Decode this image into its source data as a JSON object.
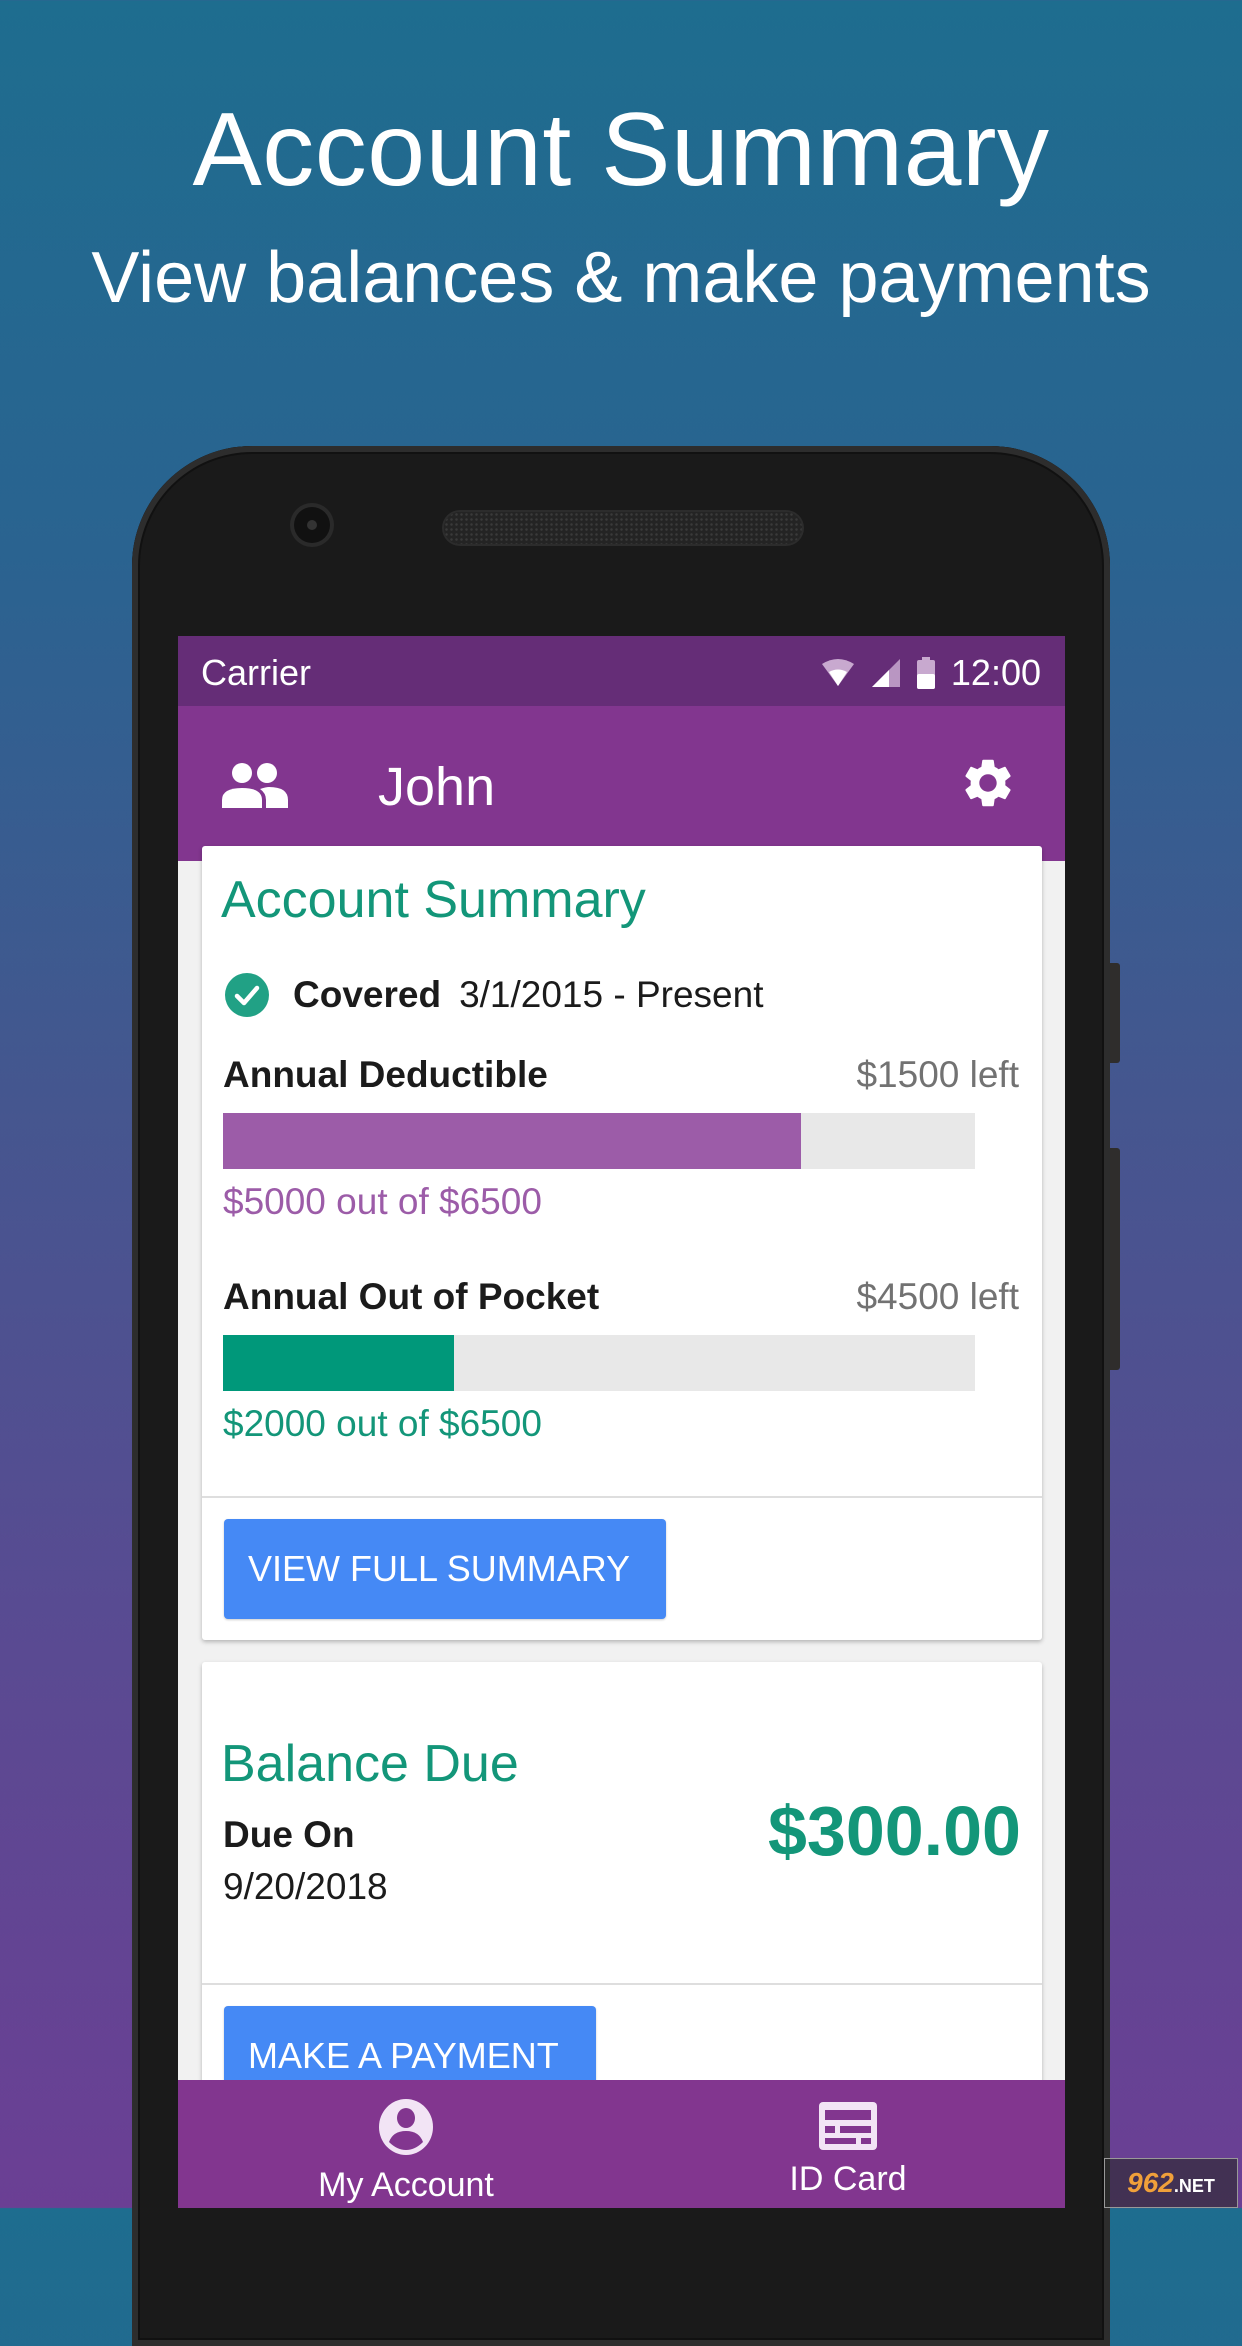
{
  "promo": {
    "title": "Account Summary",
    "subtitle": "View balances & make payments"
  },
  "status_bar": {
    "carrier": "Carrier",
    "time": "12:00",
    "icons": [
      "wifi-icon",
      "cell-signal-icon",
      "battery-icon"
    ]
  },
  "app_bar": {
    "title": "John",
    "left_icon": "people-icon",
    "right_icon": "gear-icon"
  },
  "account_summary": {
    "title": "Account Summary",
    "coverage": {
      "status": "Covered",
      "period": "3/1/2015 - Present",
      "icon": "check-circle-icon"
    },
    "meters": [
      {
        "label": "Annual Deductible",
        "remaining": "$1500 left",
        "caption": "$5000 out of $6500",
        "used": 5000,
        "total": 6500,
        "color": "#9c5ca8",
        "caption_color": "#9c5ca8"
      },
      {
        "label": "Annual Out of Pocket",
        "remaining": "$4500 left",
        "caption": "$2000 out of $6500",
        "used": 2000,
        "total": 6500,
        "color": "#00987a",
        "caption_color": "#139679"
      }
    ],
    "button": "VIEW FULL SUMMARY"
  },
  "balance_due": {
    "title": "Balance Due",
    "due_label": "Due On",
    "due_date": "9/20/2018",
    "amount": "$300.00",
    "button": "MAKE A PAYMENT"
  },
  "bottom_nav": {
    "items": [
      {
        "label": "My Account",
        "icon": "account-circle-icon"
      },
      {
        "label": "ID Card",
        "icon": "id-card-icon"
      }
    ]
  },
  "watermark": {
    "brand": "962",
    "suffix": ".NET"
  },
  "colors": {
    "primary": "#82368f",
    "primary_dark": "#652d77",
    "accent_green": "#139679",
    "button_blue": "#4589f5"
  }
}
